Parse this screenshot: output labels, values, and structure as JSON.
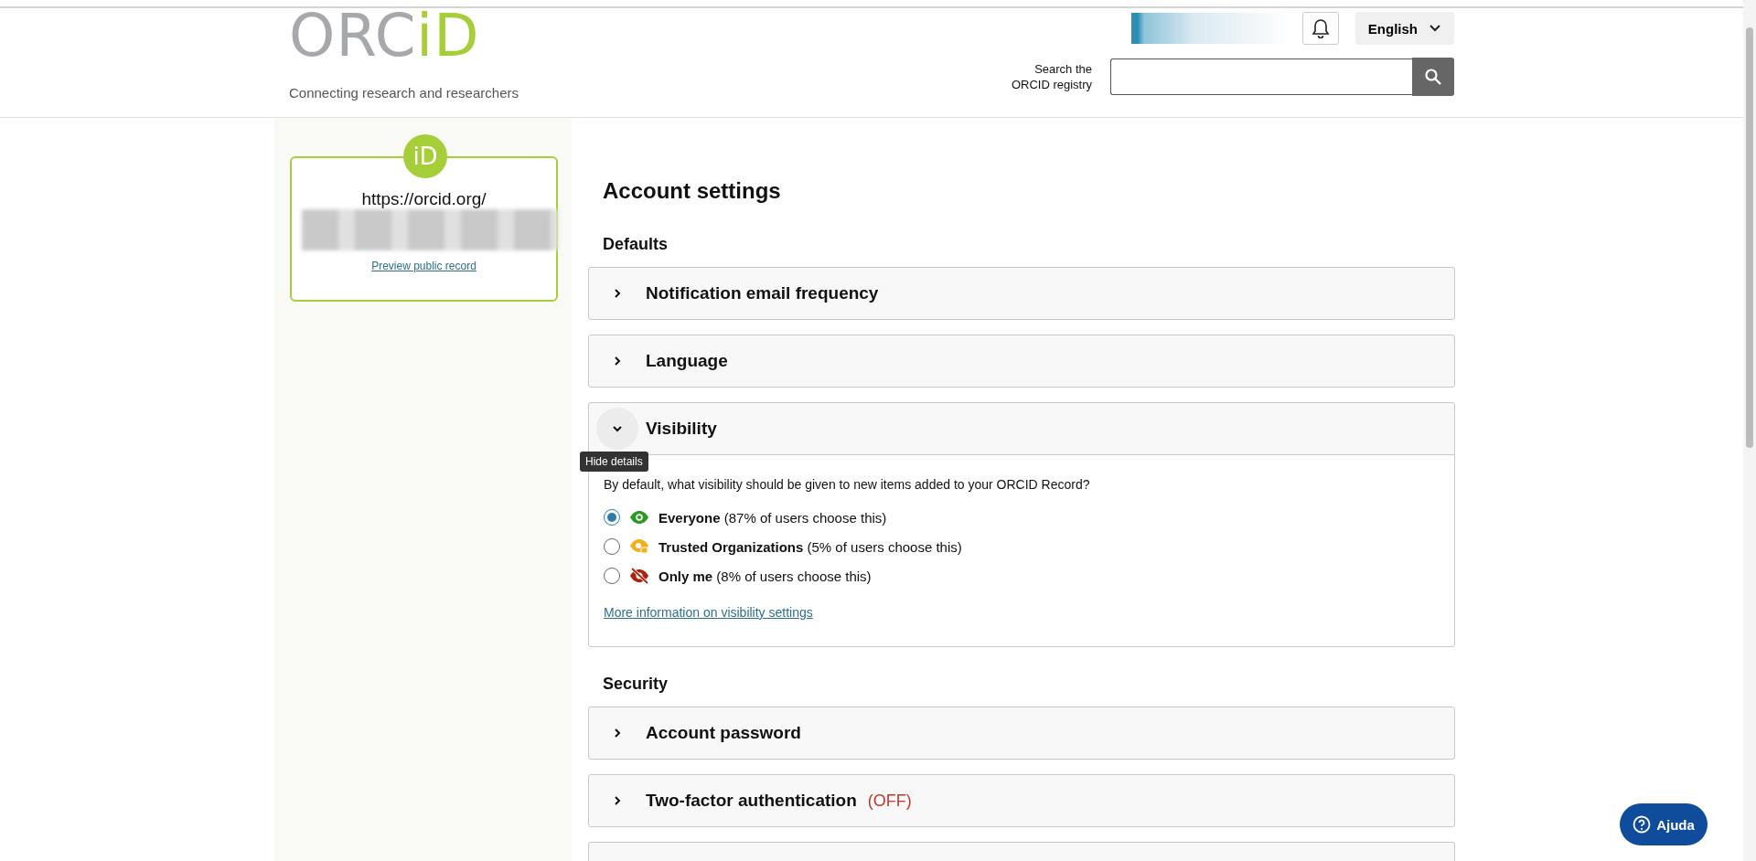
{
  "header": {
    "logo": {
      "part_1": "ORC",
      "part_2": "iD"
    },
    "tagline": "Connecting research and researchers",
    "language": "English",
    "search_label": [
      "Search the",
      "ORCID registry"
    ]
  },
  "profile_card": {
    "badge": "iD",
    "url_prefix": "https://orcid.org/",
    "link": "Preview public record"
  },
  "main": {
    "title": "Account settings",
    "sections": [
      {
        "heading": "Defaults",
        "panels": [
          {
            "title": "Notification email frequency",
            "expanded": false
          },
          {
            "title": "Language",
            "expanded": false
          },
          {
            "title": "Visibility",
            "expanded": true,
            "tooltip": "Hide details",
            "description": "By default, what visibility should be given to new items added to your ORCID Record?",
            "options": [
              {
                "kind": "everyone",
                "label": "Everyone",
                "note": "(87% of users choose this)",
                "selected": true
              },
              {
                "kind": "trusted",
                "label": "Trusted Organizations",
                "note": "(5% of users choose this)",
                "selected": false
              },
              {
                "kind": "private",
                "label": "Only me",
                "note": "(8% of users choose this)",
                "selected": false
              }
            ],
            "link": "More information on visibility settings"
          }
        ]
      },
      {
        "heading": "Security",
        "panels": [
          {
            "title": "Account password",
            "expanded": false
          },
          {
            "title": "Two-factor authentication",
            "status": "(OFF)",
            "expanded": false
          }
        ]
      }
    ]
  },
  "help_button": "Ajuda"
}
